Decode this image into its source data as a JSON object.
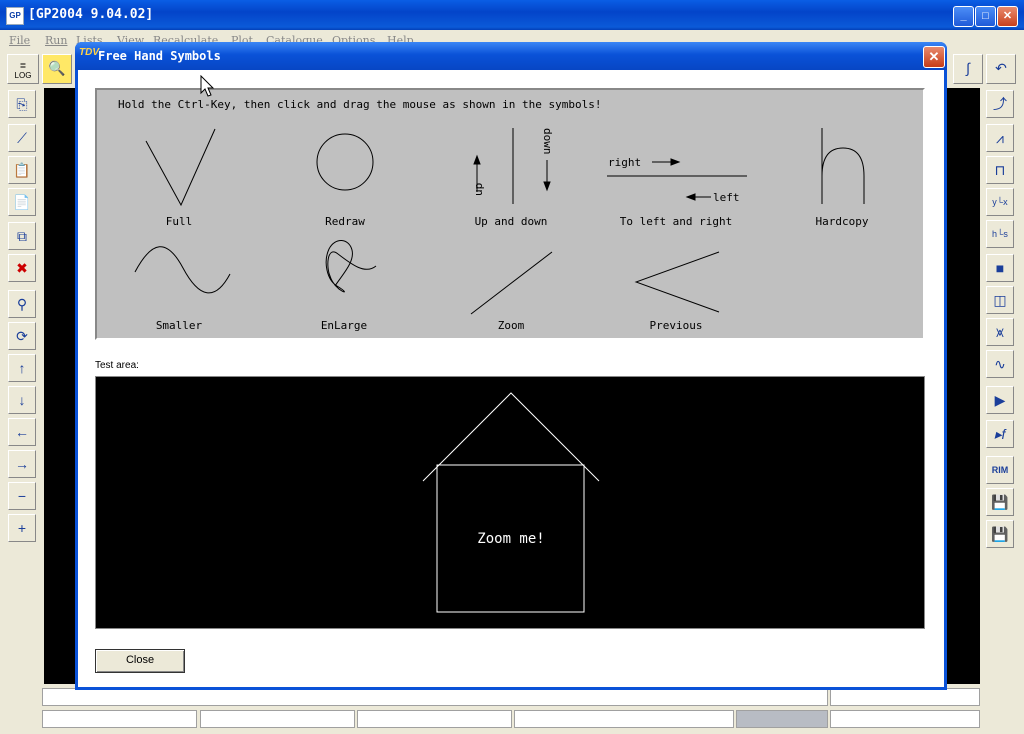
{
  "main_window": {
    "app_icon": "GP",
    "title": "[GP2004   9.04.02]",
    "minimize_glyph": "_",
    "maximize_glyph": "□",
    "close_glyph": "✕",
    "menu": [
      "File",
      "Run",
      "Lists",
      "View",
      "Recalculate",
      "Plot",
      "Catalogue",
      "Options",
      "Help"
    ],
    "log_button": "LOG"
  },
  "dialog": {
    "icon": "TDV",
    "title": "Free Hand Symbols",
    "close_glyph": "✕",
    "instruction": "Hold the Ctrl-Key, then click and drag the mouse as shown in the symbols!",
    "symbols": {
      "full": "Full",
      "redraw": "Redraw",
      "up_down": "Up and down",
      "left_right": "To left and right",
      "hardcopy": "Hardcopy",
      "smaller": "Smaller",
      "enlarge": "EnLarge",
      "zoom": "Zoom",
      "previous": "Previous"
    },
    "arrow_text": {
      "up": "up",
      "down": "down",
      "right": "right",
      "left": "left"
    },
    "test_area_label": "Test area:",
    "test_area_text": "Zoom me!",
    "close_button": "Close"
  },
  "icons": {
    "left_toolbar": [
      "copy-plot-icon",
      "plot-line-icon",
      "paste-plot-icon",
      "copy-page-icon",
      "copy-all-icon",
      "delete-plot-icon",
      "zoom-window-icon",
      "zoom-rotate-icon",
      "zoom-up-icon",
      "zoom-down-icon",
      "zoom-left-icon",
      "zoom-right-icon",
      "zoom-out-icon",
      "zoom-in-icon"
    ],
    "right_toolbar": [
      "plot-graph-icon",
      "plot-frequency-icon",
      "plot-hold-icon",
      "plot-yx-icon",
      "plot-hs-icon",
      "plot-3d-icon",
      "plot-frame-icon",
      "plot-noise-icon",
      "plot-curve-icon",
      "run-icon",
      "run-function-icon",
      "rim-icon",
      "save-left-icon",
      "save-right-icon"
    ]
  }
}
